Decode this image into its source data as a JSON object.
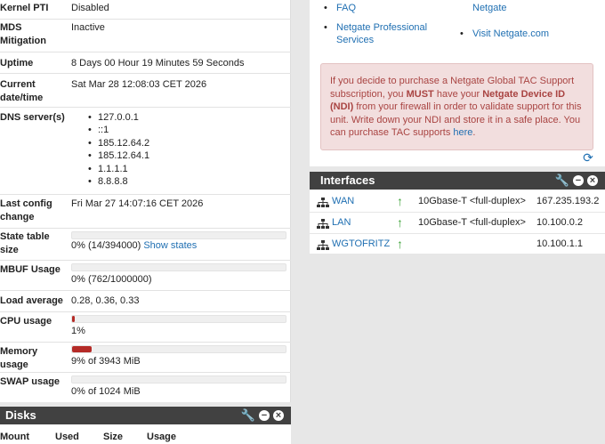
{
  "system": {
    "rows": [
      {
        "label": "Kernel PTI",
        "value": "Disabled"
      },
      {
        "label": "MDS Mitigation",
        "value": "Inactive"
      },
      {
        "label": "Uptime",
        "value": "8 Days 00 Hour 19 Minutes 59 Seconds"
      },
      {
        "label": "Current date/time",
        "value": "Sat Mar 28 12:08:03 CET 2026"
      },
      {
        "label": "DNS server(s)",
        "servers": [
          "127.0.0.1",
          "::1",
          "185.12.64.2",
          "185.12.64.1",
          "1.1.1.1",
          "8.8.8.8"
        ]
      },
      {
        "label": "Last config change",
        "value": "Fri Mar 27 14:07:16 CET 2026"
      },
      {
        "label": "State table size",
        "value": "0% (14/394000)",
        "link": "Show states",
        "fraction": 0.0
      },
      {
        "label": "MBUF Usage",
        "value": "0% (762/1000000)",
        "fraction": 0.0
      },
      {
        "label": "Load average",
        "value": "0.28, 0.36, 0.33"
      },
      {
        "label": "CPU usage",
        "value": "1%",
        "fraction": 0.01
      },
      {
        "label": "Memory usage",
        "value": "9% of 3943 MiB",
        "fraction": 0.09
      },
      {
        "label": "SWAP usage",
        "value": "0% of 1024 MiB",
        "fraction": 0.0
      }
    ]
  },
  "disks": {
    "title": "Disks",
    "columns": [
      "Mount",
      "Used",
      "Size",
      "Usage"
    ]
  },
  "netgate": {
    "links": [
      "FAQ",
      "Netgate",
      "Netgate Professional Services",
      "Visit Netgate.com"
    ],
    "alert": {
      "p1": "If you decide to purchase a Netgate Global TAC Support subscription, you ",
      "must": "MUST",
      "p2": " have your ",
      "ndi": "Netgate Device ID (NDI)",
      "p3": " from your firewall in order to validate support for this unit. Write down your NDI and store it in a safe place. You can purchase TAC supports ",
      "link": "here",
      "p4": "."
    }
  },
  "interfaces": {
    "title": "Interfaces",
    "rows": [
      {
        "name": "WAN",
        "media": "10Gbase-T <full-duplex>",
        "ip": "167.235.193.2"
      },
      {
        "name": "LAN",
        "media": "10Gbase-T <full-duplex>",
        "ip": "10.100.0.2"
      },
      {
        "name": "WGTOFRITZ",
        "media": "",
        "ip": "10.100.1.1"
      }
    ]
  },
  "colors": {
    "panel_header": "#414141",
    "link": "#1f6fb2",
    "bar_fill": "#b52b27",
    "alert_bg": "#f2dede",
    "alert_text": "#a94442",
    "status_up": "#3fa43a"
  }
}
